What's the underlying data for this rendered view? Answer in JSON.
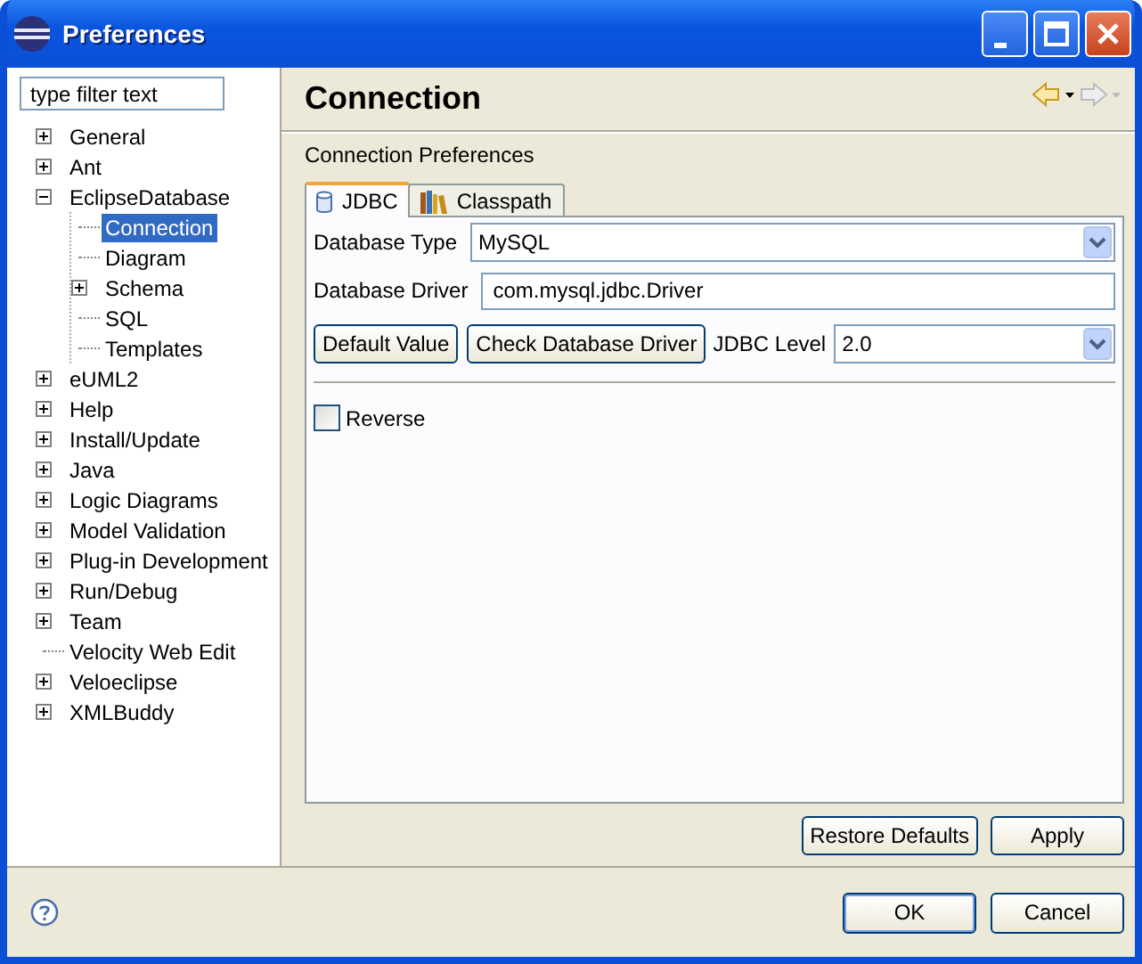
{
  "window": {
    "title": "Preferences"
  },
  "filter": {
    "placeholder": "type filter text"
  },
  "tree": [
    {
      "label": "General",
      "expanded": false,
      "selected": false
    },
    {
      "label": "Ant",
      "expanded": false,
      "selected": false
    },
    {
      "label": "EclipseDatabase",
      "expanded": true,
      "selected": false,
      "children": [
        {
          "label": "Connection",
          "selected": true
        },
        {
          "label": "Diagram",
          "selected": false
        },
        {
          "label": "Schema",
          "expanded": false,
          "selected": false
        },
        {
          "label": "SQL",
          "selected": false
        },
        {
          "label": "Templates",
          "selected": false
        }
      ]
    },
    {
      "label": "eUML2",
      "expanded": false,
      "selected": false
    },
    {
      "label": "Help",
      "expanded": false,
      "selected": false
    },
    {
      "label": "Install/Update",
      "expanded": false,
      "selected": false
    },
    {
      "label": "Java",
      "expanded": false,
      "selected": false
    },
    {
      "label": "Logic Diagrams",
      "expanded": false,
      "selected": false
    },
    {
      "label": "Model Validation",
      "expanded": false,
      "selected": false
    },
    {
      "label": "Plug-in Development",
      "expanded": false,
      "selected": false
    },
    {
      "label": "Run/Debug",
      "expanded": false,
      "selected": false
    },
    {
      "label": "Team",
      "expanded": false,
      "selected": false
    },
    {
      "label": "Velocity Web Edit",
      "selected": false
    },
    {
      "label": "Veloeclipse",
      "expanded": false,
      "selected": false
    },
    {
      "label": "XMLBuddy",
      "expanded": false,
      "selected": false
    }
  ],
  "page": {
    "title": "Connection",
    "description": "Connection Preferences"
  },
  "tabs": [
    {
      "label": "JDBC",
      "selected": true
    },
    {
      "label": "Classpath",
      "selected": false
    }
  ],
  "database_type": {
    "label": "Database Type",
    "value": "MySQL"
  },
  "database_driver": {
    "label": "Database Driver",
    "value": "com.mysql.jdbc.Driver"
  },
  "action_buttons": [
    "Default Value",
    "Check Database Driver"
  ],
  "jdbc_level": {
    "label": "JDBC Level",
    "value": "2.0"
  },
  "reverse": {
    "label": "Reverse",
    "checked": false
  },
  "page_buttons": [
    "Restore Defaults",
    "Apply"
  ],
  "dialog_buttons": [
    "OK",
    "Cancel"
  ]
}
